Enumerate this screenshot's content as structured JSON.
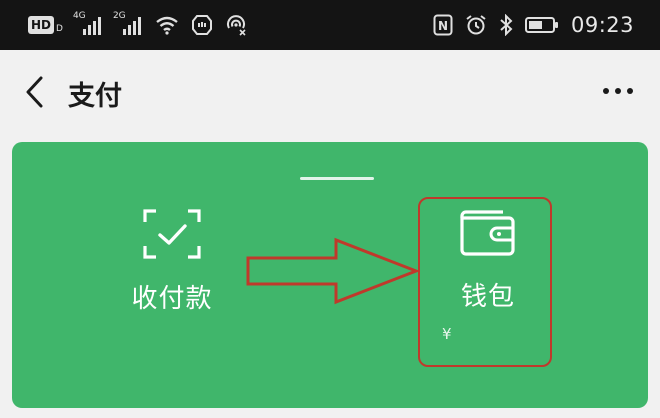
{
  "status_bar": {
    "hd_label": "HD",
    "hd_sub": "D",
    "network_1": "4G",
    "network_2": "2G",
    "nfc_label": "N",
    "time": "09:23",
    "icons": [
      "wifi-icon",
      "shield-icon",
      "hotspot-icon",
      "nfc-icon",
      "alarm-icon",
      "bluetooth-icon",
      "battery-icon"
    ]
  },
  "nav": {
    "title": "支付",
    "back_icon": "chevron-left-icon",
    "more_icon": "more-dots-icon"
  },
  "panel": {
    "background": "#40b66b",
    "tiles": [
      {
        "label": "收付款",
        "icon": "scan-check-icon"
      },
      {
        "label": "钱包",
        "icon": "wallet-icon",
        "sub": "¥"
      }
    ],
    "highlight_color": "#c0392b"
  }
}
